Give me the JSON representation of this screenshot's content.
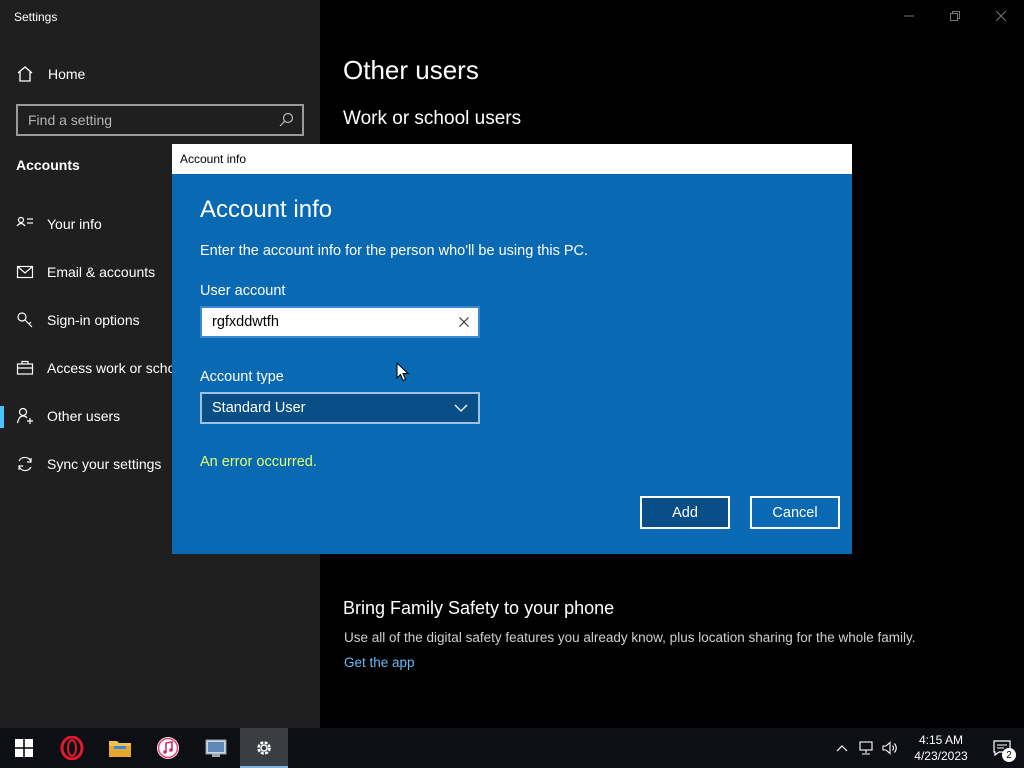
{
  "window": {
    "title": "Settings"
  },
  "sidebar": {
    "home_label": "Home",
    "search_placeholder": "Find a setting",
    "section": "Accounts",
    "items": [
      {
        "label": "Your info",
        "icon": "person-card-icon"
      },
      {
        "label": "Email & accounts",
        "icon": "mail-icon"
      },
      {
        "label": "Sign-in options",
        "icon": "key-icon"
      },
      {
        "label": "Access work or school",
        "icon": "briefcase-icon"
      },
      {
        "label": "Other users",
        "icon": "add-person-icon",
        "active": true
      },
      {
        "label": "Sync your settings",
        "icon": "sync-icon"
      }
    ]
  },
  "main": {
    "title": "Other users",
    "subtitle": "Work or school users",
    "family_title": "Bring Family Safety to your phone",
    "family_desc": "Use all of the digital safety features you already know, plus location sharing for the whole family.",
    "family_link": "Get the app"
  },
  "dialog": {
    "titlebar": "Account info",
    "heading": "Account info",
    "instruction": "Enter the account info for the person who'll be using this PC.",
    "user_label": "User account",
    "user_value": "rgfxddwtfh",
    "type_label": "Account type",
    "type_value": "Standard User",
    "error": "An error occurred.",
    "add_label": "Add",
    "cancel_label": "Cancel",
    "accent": "#0a69b3",
    "error_color": "#e3ff6b"
  },
  "taskbar": {
    "apps": [
      "start-icon",
      "opera-icon",
      "file-explorer-icon",
      "itunes-icon",
      "control-panel-icon",
      "settings-icon"
    ],
    "time": "4:15 AM",
    "date": "4/23/2023",
    "notification_count": "2"
  }
}
